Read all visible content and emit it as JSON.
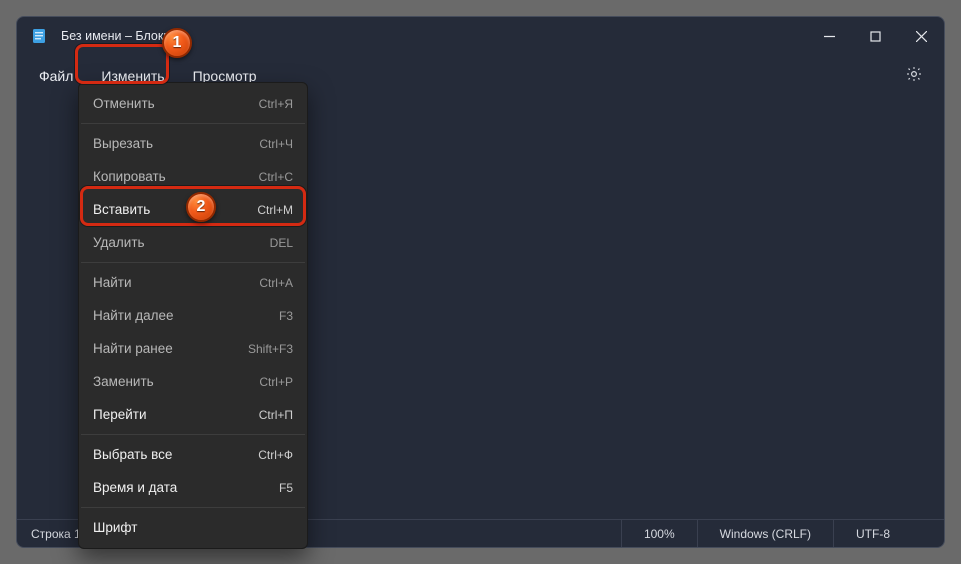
{
  "titlebar": {
    "title": "Без имени – Блокнот"
  },
  "menubar": {
    "file": "Файл",
    "edit": "Изменить",
    "view": "Просмотр"
  },
  "dropdown": {
    "undo": {
      "label": "Отменить",
      "shortcut": "Ctrl+Я"
    },
    "cut": {
      "label": "Вырезать",
      "shortcut": "Ctrl+Ч"
    },
    "copy": {
      "label": "Копировать",
      "shortcut": "Ctrl+C"
    },
    "paste": {
      "label": "Вставить",
      "shortcut": "Ctrl+М"
    },
    "delete": {
      "label": "Удалить",
      "shortcut": "DEL"
    },
    "find": {
      "label": "Найти",
      "shortcut": "Ctrl+А"
    },
    "find_next": {
      "label": "Найти далее",
      "shortcut": "F3"
    },
    "find_prev": {
      "label": "Найти ранее",
      "shortcut": "Shift+F3"
    },
    "replace": {
      "label": "Заменить",
      "shortcut": "Ctrl+P"
    },
    "goto": {
      "label": "Перейти",
      "shortcut": "Ctrl+П"
    },
    "select_all": {
      "label": "Выбрать все",
      "shortcut": "Ctrl+Ф"
    },
    "time_date": {
      "label": "Время и дата",
      "shortcut": "F5"
    },
    "font": {
      "label": "Шрифт",
      "shortcut": ""
    }
  },
  "statusbar": {
    "position": "Строка 1, столбец 1",
    "zoom": "100%",
    "line_ending": "Windows (CRLF)",
    "encoding": "UTF-8"
  },
  "callouts": {
    "one": "1",
    "two": "2"
  }
}
